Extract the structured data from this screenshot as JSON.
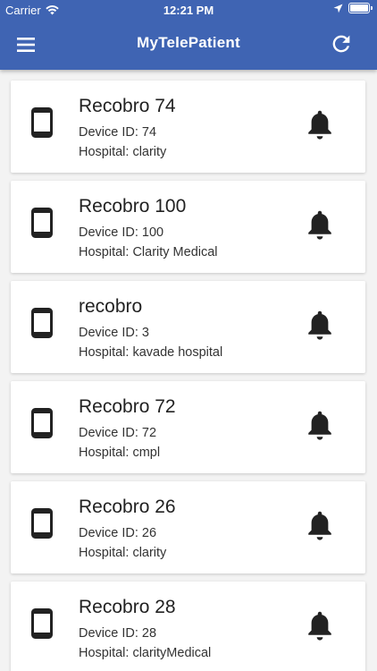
{
  "status_bar": {
    "carrier": "Carrier",
    "time": "12:21 PM"
  },
  "app_bar": {
    "title": "MyTelePatient",
    "color": "#3f64b3",
    "icons": [
      "menu-icon",
      "refresh-icon"
    ]
  },
  "devices": [
    {
      "name": "Recobro 74",
      "device_id": "Device ID: 74",
      "hospital": "Hospital: clarity"
    },
    {
      "name": "Recobro 100",
      "device_id": "Device ID: 100",
      "hospital": "Hospital: Clarity Medical"
    },
    {
      "name": "recobro",
      "device_id": "Device ID: 3",
      "hospital": "Hospital: kavade hospital"
    },
    {
      "name": "Recobro 72",
      "device_id": "Device ID: 72",
      "hospital": "Hospital: cmpl"
    },
    {
      "name": "Recobro 26",
      "device_id": "Device ID: 26",
      "hospital": "Hospital: clarity"
    },
    {
      "name": "Recobro 28",
      "device_id": "Device ID: 28",
      "hospital": "Hospital: clarityMedical"
    }
  ],
  "card_icons": [
    "phone-icon",
    "bell-icon"
  ]
}
